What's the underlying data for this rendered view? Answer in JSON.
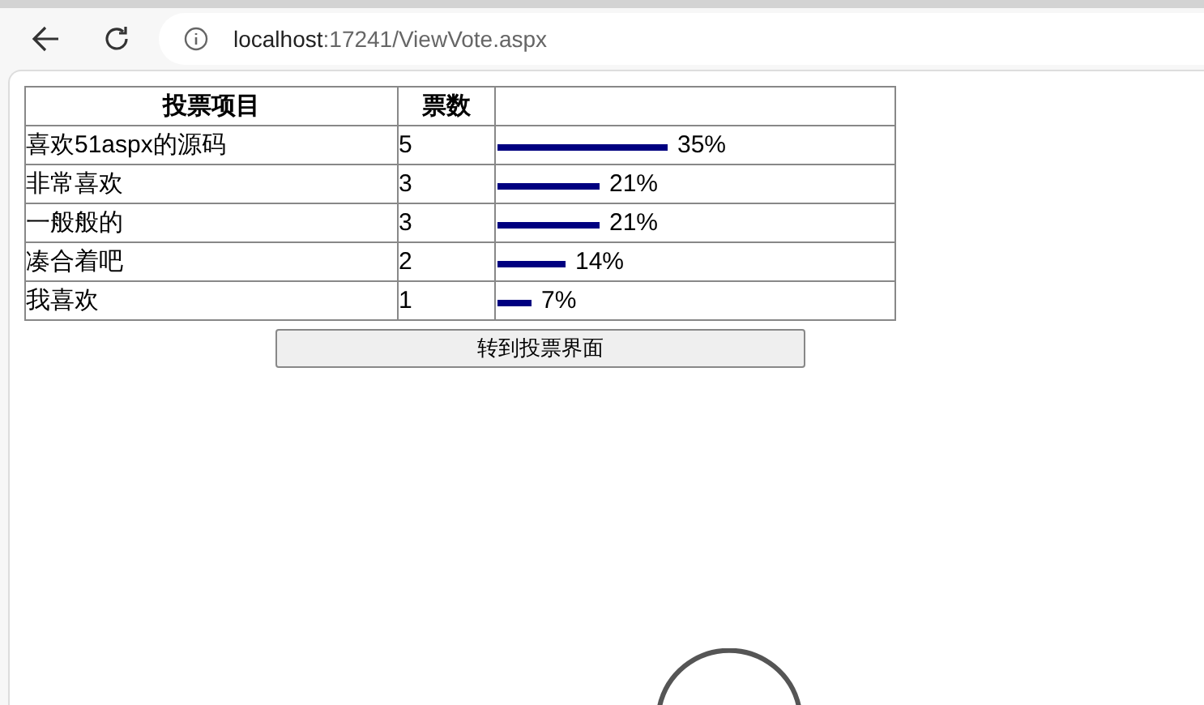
{
  "browser": {
    "url_host": "localhost",
    "url_rest": ":17241/ViewVote.aspx"
  },
  "table": {
    "columns": [
      "投票项目",
      "票数"
    ],
    "rows": [
      {
        "item": "喜欢51aspx的源码",
        "votes": "5",
        "percent": "35%"
      },
      {
        "item": "非常喜欢",
        "votes": "3",
        "percent": "21%"
      },
      {
        "item": "一般般的",
        "votes": "3",
        "percent": "21%"
      },
      {
        "item": "凑合着吧",
        "votes": "2",
        "percent": "14%"
      },
      {
        "item": "我喜欢",
        "votes": "1",
        "percent": "7%"
      }
    ]
  },
  "button": "转到投票界面"
}
